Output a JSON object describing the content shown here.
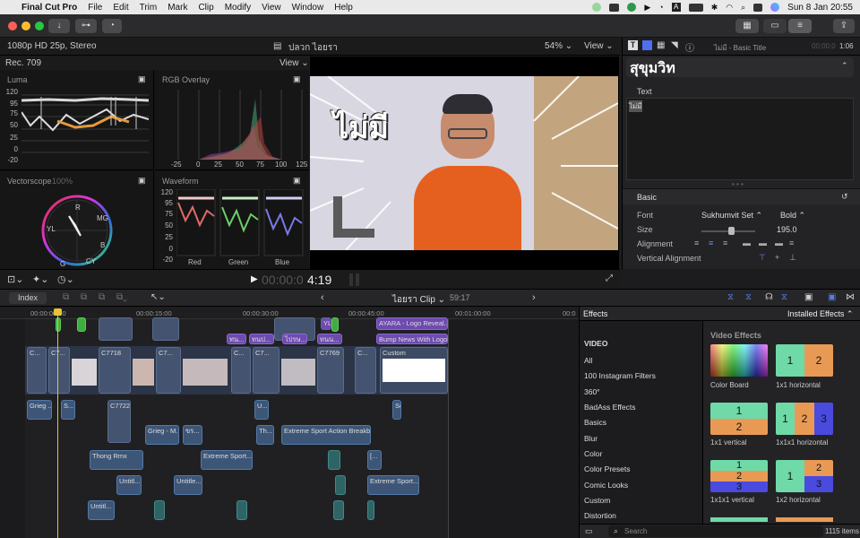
{
  "menubar": {
    "app": "Final Cut Pro",
    "items": [
      "File",
      "Edit",
      "Trim",
      "Mark",
      "Clip",
      "Modify",
      "View",
      "Window",
      "Help"
    ],
    "datetime": "Sun 8 Jan  20:55"
  },
  "viewer_bar": {
    "format": "1080p HD 25p, Stereo",
    "project": "ปลวก ไอยรา",
    "zoom": "54%",
    "view": "View"
  },
  "scopes": {
    "colorspace": "Rec. 709",
    "view": "View",
    "luma": {
      "title": "Luma",
      "ticks": [
        "120",
        "95",
        "75",
        "50",
        "25",
        "0",
        "-20"
      ]
    },
    "rgb": {
      "title": "RGB Overlay",
      "xticks": [
        "-25",
        "0",
        "25",
        "50",
        "75",
        "100",
        "125"
      ]
    },
    "vector": {
      "title": "Vectorscope",
      "pct": "100%",
      "labels": [
        "R",
        "MG",
        "B",
        "CY",
        "G",
        "YL"
      ]
    },
    "waveform": {
      "title": "Waveform",
      "ticks": [
        "120",
        "95",
        "75",
        "50",
        "25",
        "0",
        "-20"
      ],
      "channels": [
        "Red",
        "Green",
        "Blue"
      ]
    }
  },
  "viewer": {
    "title_text": "ไม่มี",
    "timecode_dim": "00:00:0",
    "timecode": "4:19"
  },
  "inspector": {
    "clip_name": "ไม่มี - Basic Title",
    "duration_dim": "00:00:0",
    "duration": "1:06",
    "font_big": "สุขุมวิท",
    "text_section": "Text",
    "text_value": "ไม่มี",
    "basic": "Basic",
    "rows": [
      {
        "label": "Font",
        "value": "Sukhumvit Set",
        "value2": "Bold"
      },
      {
        "label": "Size",
        "value": "",
        "value2": "195.0"
      },
      {
        "label": "Alignment",
        "value": "",
        "value2": ""
      },
      {
        "label": "Vertical Alignment",
        "value": "",
        "value2": ""
      }
    ],
    "size_level": 0.55
  },
  "timeline_header": {
    "index": "Index",
    "clip": "ไอยรา Clip",
    "duration": "59:17"
  },
  "ruler": [
    "00:00:00:00",
    "00:00:15:00",
    "00:00:30:00",
    "00:00:45:00",
    "00:01:00:00",
    "00:0"
  ],
  "clips": {
    "top": [
      "YL",
      "AYARA - Logo Reveal...",
      "Bump News With Logo",
      "ทน...",
      "ทนป...",
      "ไปรษ...",
      "ทนน..."
    ],
    "primary": [
      "C...",
      "C7...",
      "C7718",
      "C7...",
      "C...",
      "C7...",
      "C7769",
      "C...",
      "Custom"
    ],
    "below": [
      "Grieg ...",
      "S...",
      "C7722",
      "U...",
      "Grieg - M...",
      "ขร...",
      "Th...",
      "Extreme Sport Action Breakb...",
      "Thong Rmx",
      "Extreme Sport...",
      "Untitl...",
      "Untitle...",
      "Extreme Sport...",
      "Untitl...",
      "Sc...",
      "[..."
    ]
  },
  "effects": {
    "title": "Effects",
    "installed": "Installed Effects",
    "category_header": "VIDEO",
    "categories": [
      "All",
      "100 Instagram Filters",
      "360°",
      "BadAss Effects",
      "Basics",
      "Blur",
      "Color",
      "Color Presets",
      "Comic Looks",
      "Custom",
      "Distortion"
    ],
    "section": "Video Effects",
    "items": [
      "Color Board",
      "1x1 horizontal",
      "1x1 vertical",
      "1x1x1 horizontal",
      "1x1x1 vertical",
      "1x2 horizontal"
    ],
    "search_placeholder": "Search",
    "count": "1115 items",
    "colors": {
      "teal": "#6fd9a8",
      "orange": "#e89a54",
      "blue": "#4a4adf"
    }
  }
}
